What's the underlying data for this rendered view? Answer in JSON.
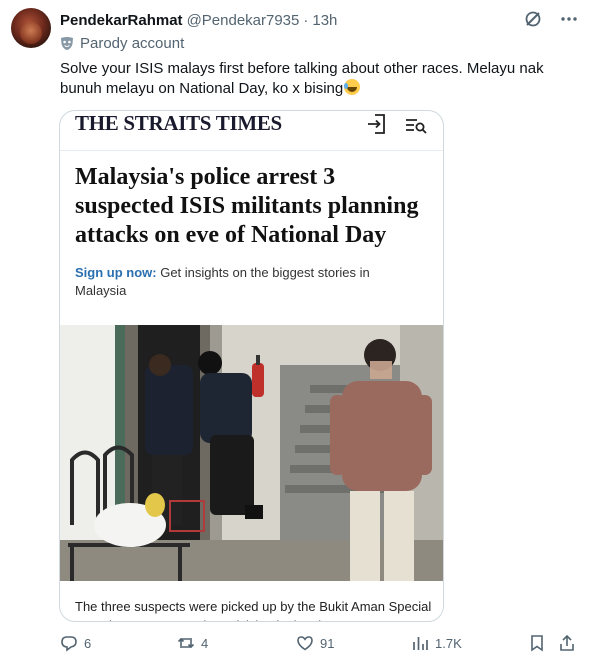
{
  "author": {
    "name": "PendekarRahmat",
    "handle": "@Pendekar7935",
    "separator": "·",
    "time": "13h",
    "label": "Parody account"
  },
  "tweet": {
    "text": "Solve your ISIS malays first before talking about other races. Melayu nak bunuh melayu on National Day, ko x bising",
    "emoji": "face-with-tears-of-joy"
  },
  "card": {
    "masthead": "THE STRAITS TIMES",
    "headline": "Malaysia's police arrest 3 suspected ISIS militants planning attacks on eve of National Day",
    "signup_cta": "Sign up now:",
    "signup_text": " Get insights on the biggest stories in Malaysia",
    "caption": "The three suspects were picked up by the Bukit Aman Special Branch Counter Terrorism Division in the city"
  },
  "actions": {
    "replies": "6",
    "reposts": "4",
    "likes": "91",
    "views": "1.7K"
  },
  "icons": [
    "grok-icon",
    "more-icon",
    "parody-mask-icon",
    "login-icon",
    "search-menu-icon",
    "reply-icon",
    "repost-icon",
    "like-icon",
    "views-icon",
    "bookmark-icon",
    "share-icon"
  ],
  "colors": {
    "text": "#0f1419",
    "muted": "#536471",
    "link": "#2a6fb0",
    "border": "#cfd9de"
  }
}
